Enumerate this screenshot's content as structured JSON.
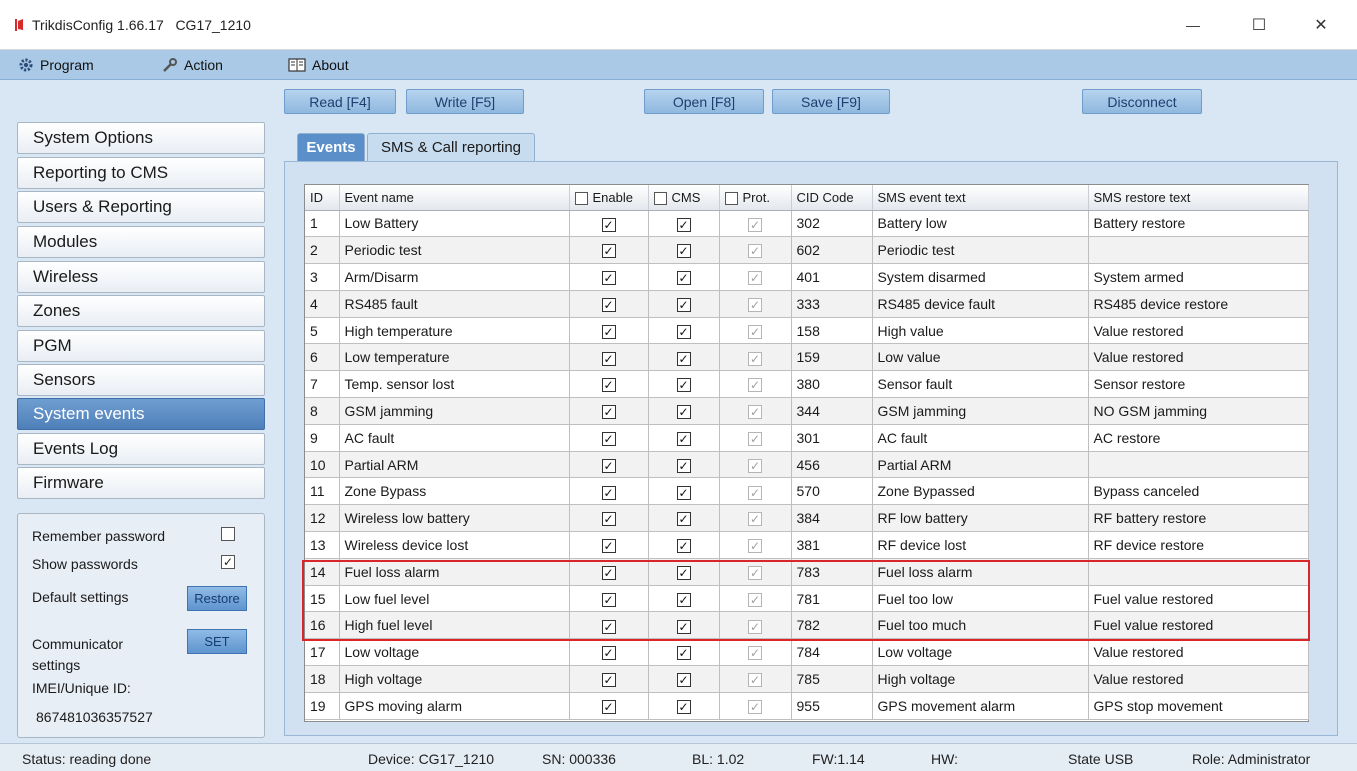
{
  "window": {
    "title": "TrikdisConfig 1.66.17   CG17_1210",
    "minimize": "—",
    "maximize": "☐",
    "close": "✕",
    "icon_color": "#d62b2b"
  },
  "menu": {
    "program": "Program",
    "action": "Action",
    "about": "About"
  },
  "toolbar": {
    "read": "Read [F4]",
    "write": "Write [F5]",
    "open": "Open [F8]",
    "save": "Save [F9]",
    "disconnect": "Disconnect"
  },
  "sidebar": {
    "items": [
      {
        "label": "System Options",
        "active": false
      },
      {
        "label": "Reporting to CMS",
        "active": false
      },
      {
        "label": "Users & Reporting",
        "active": false
      },
      {
        "label": "Modules",
        "active": false
      },
      {
        "label": "Wireless",
        "active": false
      },
      {
        "label": "Zones",
        "active": false
      },
      {
        "label": "PGM",
        "active": false
      },
      {
        "label": "Sensors",
        "active": false
      },
      {
        "label": "System events",
        "active": true
      },
      {
        "label": "Events Log",
        "active": false
      },
      {
        "label": "Firmware",
        "active": false
      }
    ]
  },
  "settings": {
    "remember_password": "Remember password",
    "remember_checked": "",
    "show_passwords": "Show passwords",
    "show_checked": "✓",
    "default_settings": "Default settings",
    "restore": "Restore",
    "communicator_settings": "Communicator settings",
    "set": "SET",
    "imei_label": "IMEI/Unique ID:",
    "imei_value": "867481036357527"
  },
  "tabs": [
    {
      "label": "Events",
      "active": true
    },
    {
      "label": "SMS & Call reporting",
      "active": false
    }
  ],
  "table": {
    "columns": [
      "ID",
      "Event name",
      "Enable",
      "CMS",
      "Prot.",
      "CID Code",
      "SMS event text",
      "SMS restore text"
    ],
    "check_mark": "✓",
    "rows": [
      {
        "id": "1",
        "name": "Low Battery",
        "cid": "302",
        "sms": "Battery low",
        "restore": "Battery restore"
      },
      {
        "id": "2",
        "name": "Periodic test",
        "cid": "602",
        "sms": "Periodic test",
        "restore": ""
      },
      {
        "id": "3",
        "name": "Arm/Disarm",
        "cid": "401",
        "sms": "System disarmed",
        "restore": "System armed"
      },
      {
        "id": "4",
        "name": "RS485 fault",
        "cid": "333",
        "sms": "RS485 device fault",
        "restore": "RS485 device restore"
      },
      {
        "id": "5",
        "name": "High temperature",
        "cid": "158",
        "sms": "High value",
        "restore": "Value restored"
      },
      {
        "id": "6",
        "name": "Low temperature",
        "cid": "159",
        "sms": "Low value",
        "restore": "Value restored"
      },
      {
        "id": "7",
        "name": "Temp. sensor lost",
        "cid": "380",
        "sms": "Sensor fault",
        "restore": "Sensor restore"
      },
      {
        "id": "8",
        "name": "GSM jamming",
        "cid": "344",
        "sms": "GSM jamming",
        "restore": "NO GSM jamming"
      },
      {
        "id": "9",
        "name": "AC fault",
        "cid": "301",
        "sms": "AC fault",
        "restore": "AC restore"
      },
      {
        "id": "10",
        "name": "Partial ARM",
        "cid": "456",
        "sms": "Partial ARM",
        "restore": ""
      },
      {
        "id": "11",
        "name": "Zone Bypass",
        "cid": "570",
        "sms": "Zone Bypassed",
        "restore": "Bypass canceled"
      },
      {
        "id": "12",
        "name": "Wireless low battery",
        "cid": "384",
        "sms": "RF low battery",
        "restore": "RF battery restore"
      },
      {
        "id": "13",
        "name": "Wireless device lost",
        "cid": "381",
        "sms": "RF device lost",
        "restore": "RF device restore"
      },
      {
        "id": "14",
        "name": "Fuel loss alarm",
        "cid": "783",
        "sms": "Fuel loss alarm",
        "restore": ""
      },
      {
        "id": "15",
        "name": "Low fuel level",
        "cid": "781",
        "sms": "Fuel too low",
        "restore": "Fuel value restored"
      },
      {
        "id": "16",
        "name": "High fuel level",
        "cid": "782",
        "sms": "Fuel too much",
        "restore": "Fuel value restored"
      },
      {
        "id": "17",
        "name": "Low voltage",
        "cid": "784",
        "sms": "Low voltage",
        "restore": "Value restored"
      },
      {
        "id": "18",
        "name": "High voltage",
        "cid": "785",
        "sms": "High voltage",
        "restore": "Value restored"
      },
      {
        "id": "19",
        "name": "GPS moving alarm",
        "cid": "955",
        "sms": "GPS movement alarm",
        "restore": "GPS stop movement"
      }
    ],
    "highlight_color": "#d9262b"
  },
  "status": {
    "status": "Status: reading done",
    "device": "Device: CG17_1210",
    "sn": "SN: 000336",
    "bl": "BL: 1.02",
    "fw": "FW:1.14",
    "hw": "HW:",
    "state": "State USB",
    "role": "Role: Administrator"
  }
}
